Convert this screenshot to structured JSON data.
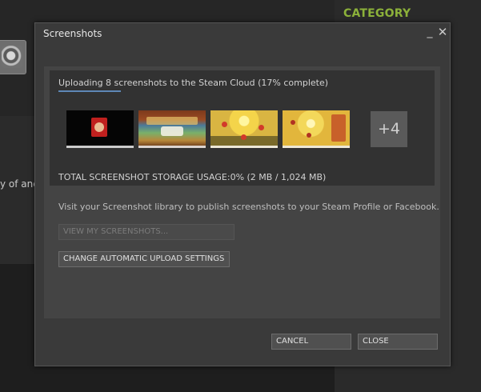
{
  "background": {
    "category_label": "CATEGORY",
    "fragment_text": "y of ancie",
    "accent_color": "#8cb13a"
  },
  "dialog": {
    "title": "Screenshots",
    "window_controls": {
      "minimize_icon": "_",
      "close_icon": "✕"
    },
    "upload": {
      "status_text": "Uploading 8 screenshots to the Steam Cloud (17% complete)",
      "progress_fraction": 0.17,
      "progress_color": "#5e87b6",
      "thumbnails": [
        "screenshot-1",
        "screenshot-2",
        "screenshot-3",
        "screenshot-4"
      ],
      "more_count_label": "+4",
      "storage_text": "TOTAL SCREENSHOT STORAGE USAGE:0% (2 MB / 1,024 MB)"
    },
    "info_text": "Visit your Screenshot library to publish screenshots to your Steam Profile or Facebook.",
    "buttons": {
      "view_screenshots": "VIEW MY SCREENSHOTS...",
      "change_settings": "CHANGE AUTOMATIC UPLOAD SETTINGS",
      "cancel": "CANCEL",
      "close": "CLOSE"
    }
  }
}
